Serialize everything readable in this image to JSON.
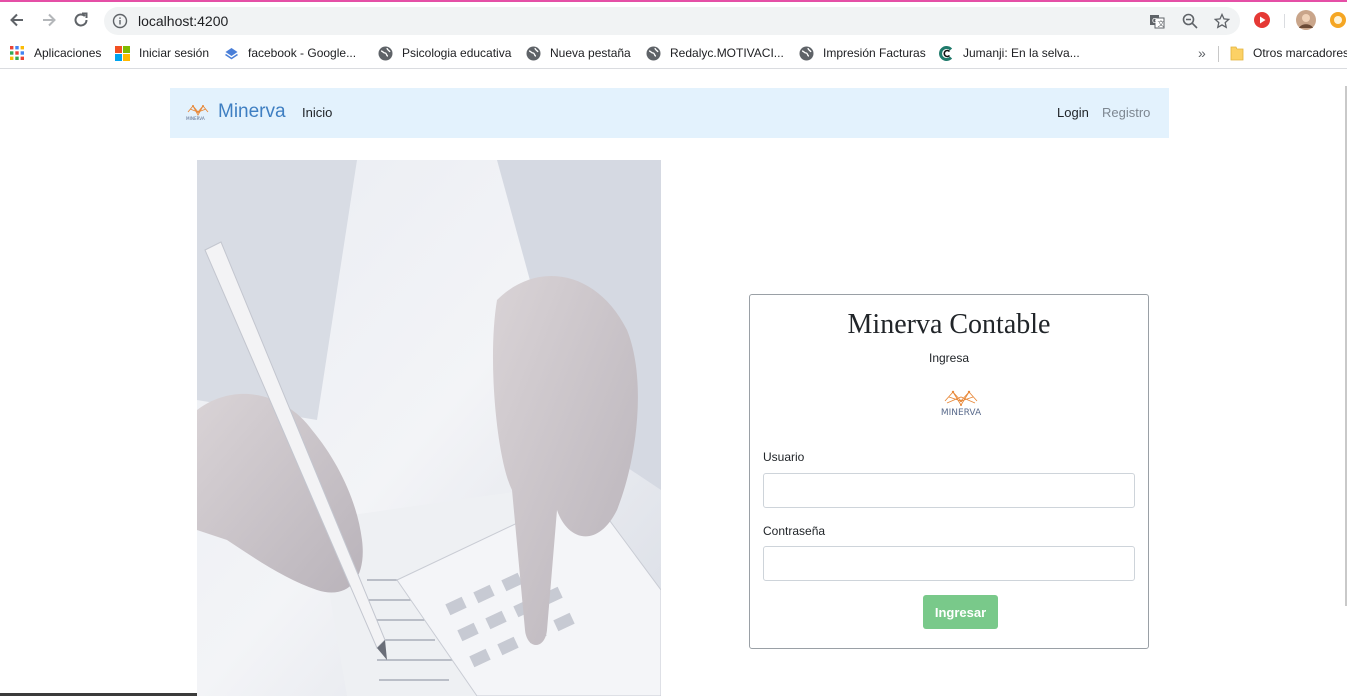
{
  "browser": {
    "url": "localhost:4200",
    "bookmarks": [
      {
        "label": "Aplicaciones",
        "icon": "apps-grid-icon"
      },
      {
        "label": "Iniciar sesión",
        "icon": "microsoft-icon"
      },
      {
        "label": "facebook - Google...",
        "icon": "blue-diamond-icon"
      },
      {
        "label": "Psicologia educativa",
        "icon": "globe-icon"
      },
      {
        "label": "Nueva pestaña",
        "icon": "globe-icon"
      },
      {
        "label": "Redalyc.MOTIVACI...",
        "icon": "globe-icon"
      },
      {
        "label": "Impresión Facturas",
        "icon": "globe-icon"
      },
      {
        "label": "Jumanji: En la selva...",
        "icon": "cinema-icon"
      }
    ],
    "more_bookmarks": "»",
    "other_bookmarks": "Otros marcadores"
  },
  "navbar": {
    "brand": "Minerva",
    "brand_logo_text": "MINERVA",
    "links": {
      "inicio": "Inicio",
      "login": "Login",
      "registro": "Registro"
    }
  },
  "login_card": {
    "title": "Minerva Contable",
    "subtitle": "Ingresa",
    "logo_text": "MINERVA",
    "username_label": "Usuario",
    "username_value": "",
    "password_label": "Contraseña",
    "password_value": "",
    "submit_label": "Ingresar"
  },
  "colors": {
    "navbar_bg": "#e3f2fd",
    "brand": "#3f7fc2",
    "submit_button": "#79c98a",
    "logo_accent": "#e8893a"
  }
}
